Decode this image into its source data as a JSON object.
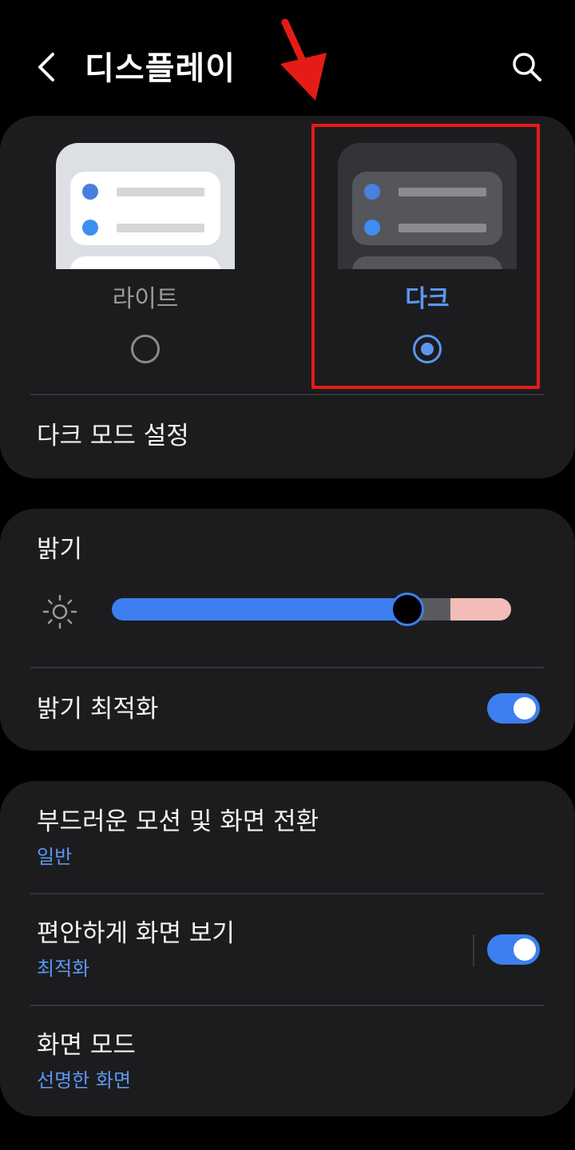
{
  "header": {
    "title": "디스플레이",
    "back_icon": "chevron-left-icon",
    "search_icon": "search-icon"
  },
  "theme": {
    "light_label": "라이트",
    "dark_label": "다크",
    "selected": "dark",
    "dark_mode_settings": "다크 모드 설정",
    "accent_color": "#5b96f0"
  },
  "brightness": {
    "title": "밝기",
    "level": 0.74,
    "adaptive_label": "밝기 최적화",
    "adaptive_on": true
  },
  "motion": {
    "title": "부드러운 모션 및 화면 전환",
    "value": "일반"
  },
  "eye_comfort": {
    "title": "편안하게 화면 보기",
    "value": "최적화",
    "on": true
  },
  "screen_mode": {
    "title": "화면 모드",
    "value": "선명한 화면"
  },
  "colors": {
    "toggle_on": "#3d7ff0",
    "annotation": "#e41b17"
  }
}
